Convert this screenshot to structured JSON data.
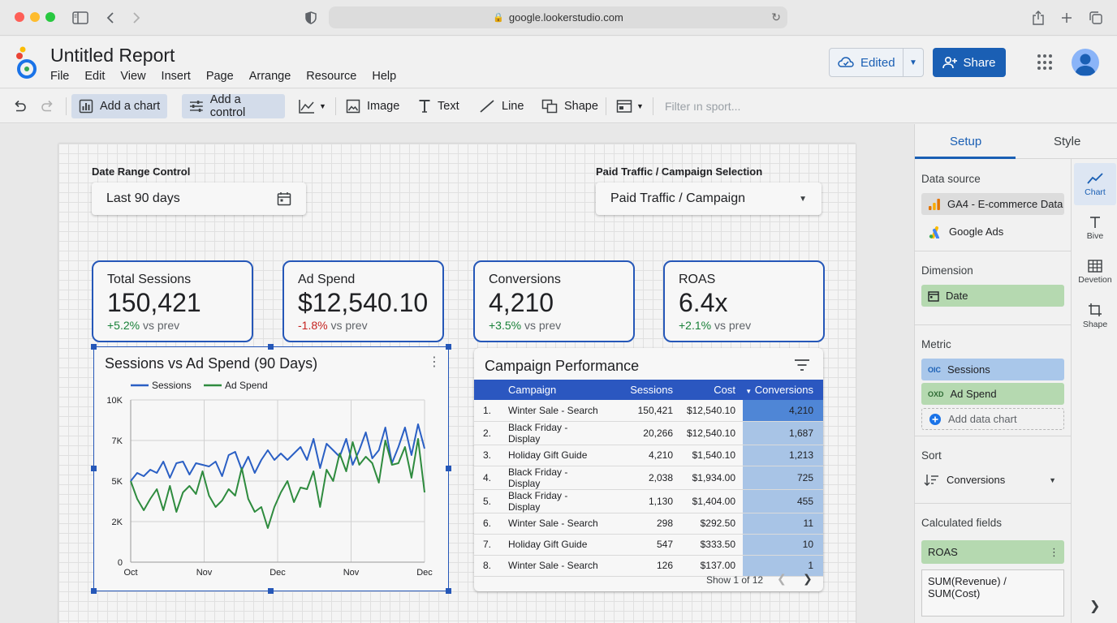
{
  "browser": {
    "url": "google.lookerstudio.com"
  },
  "header": {
    "title": "Untitled Report",
    "menu": [
      "File",
      "Edit",
      "View",
      "Insert",
      "Page",
      "Arrange",
      "Resource",
      "Help"
    ],
    "edited_label": "Edited",
    "share_label": "Share"
  },
  "toolbar": {
    "add_chart": "Add a chart",
    "add_control": "Add a control",
    "image": "Image",
    "text": "Text",
    "line": "Line",
    "shape": "Shape",
    "filter_placeholder": "Filter ın sport..."
  },
  "controls": {
    "date_range": {
      "label": "Date Range Control",
      "value": "Last 90 days"
    },
    "selection": {
      "label": "Paid Traffic / Campaign Selection",
      "value": "Paid Traffic / Campaign"
    }
  },
  "kpis": [
    {
      "label": "Total Sessions",
      "value": "150,421",
      "delta": "+5.2%",
      "delta_suffix": "vs prev",
      "trend": "up"
    },
    {
      "label": "Ad Spend",
      "value": "$12,540.10",
      "delta": "-1.8%",
      "delta_suffix": "vs prev",
      "trend": "down"
    },
    {
      "label": "Conversions",
      "value": "4,210",
      "delta": "+3.5%",
      "delta_suffix": "vs prev",
      "trend": "up"
    },
    {
      "label": "ROAS",
      "value": "6.4x",
      "delta": "+2.1%",
      "delta_suffix": "vs prev",
      "trend": "up"
    }
  ],
  "chart": {
    "title": "Sessions vs Ad Spend (90 Days)"
  },
  "chart_data": {
    "type": "line",
    "title": "Sessions vs Ad Spend (90 Days)",
    "x_tick_labels": [
      "Oct",
      "Nov",
      "Dec",
      "Nov",
      "Dec"
    ],
    "y_tick_labels": [
      "0",
      "2K",
      "5K",
      "7K",
      "10K"
    ],
    "y_tick_values": [
      0,
      2500,
      5000,
      7500,
      10000
    ],
    "ylim": [
      0,
      10000
    ],
    "grid": true,
    "legend_position": "top-left",
    "series": [
      {
        "name": "Sessions",
        "color": "#2a5fc4",
        "values": [
          5000,
          5500,
          5300,
          5700,
          5500,
          6200,
          5200,
          6100,
          6200,
          5400,
          6100,
          6000,
          5900,
          6200,
          5300,
          6600,
          6800,
          5700,
          6500,
          5500,
          6300,
          6900,
          6300,
          6700,
          6300,
          6700,
          7100,
          6300,
          7600,
          5800,
          7300,
          6900,
          6500,
          7600,
          6000,
          6900,
          8000,
          6400,
          6900,
          8300,
          6100,
          7100,
          8300,
          6600,
          8500,
          7000
        ]
      },
      {
        "name": "Ad Spend",
        "color": "#2e8b3e",
        "values": [
          5000,
          3900,
          3200,
          3900,
          4500,
          3200,
          4700,
          3100,
          4300,
          4700,
          4200,
          5600,
          4100,
          3400,
          3800,
          4500,
          4100,
          5800,
          3900,
          3100,
          3400,
          2100,
          3400,
          4300,
          5000,
          3700,
          4600,
          4500,
          5600,
          3400,
          5700,
          5000,
          6700,
          5600,
          7400,
          6000,
          6500,
          6100,
          4900,
          7500,
          6000,
          6100,
          7100,
          5200,
          7600,
          4300
        ]
      }
    ]
  },
  "table": {
    "title": "Campaign Performance",
    "headers": {
      "campaign": "Campaign",
      "sessions": "Sessions",
      "cost": "Cost",
      "conversions": "Conversions"
    },
    "rows": [
      {
        "n": "1.",
        "campaign": "Winter Sale - Search",
        "sessions": "150,421",
        "cost": "$12,540.10",
        "conversions": "4,210"
      },
      {
        "n": "2.",
        "campaign": "Black Friday - Display",
        "sessions": "20,266",
        "cost": "$12,540.10",
        "conversions": "1,687"
      },
      {
        "n": "3.",
        "campaign": "Holiday Gift Guide",
        "sessions": "4,210",
        "cost": "$1,540.10",
        "conversions": "1,213"
      },
      {
        "n": "4.",
        "campaign": "Black Friday - Display",
        "sessions": "2,038",
        "cost": "$1,934.00",
        "conversions": "725"
      },
      {
        "n": "5.",
        "campaign": "Black Friday - Display",
        "sessions": "1,130",
        "cost": "$1,404.00",
        "conversions": "455"
      },
      {
        "n": "6.",
        "campaign": "Winter Sale - Search",
        "sessions": "298",
        "cost": "$292.50",
        "conversions": "11"
      },
      {
        "n": "7.",
        "campaign": "Holiday Gift Guide",
        "sessions": "547",
        "cost": "$333.50",
        "conversions": "10"
      },
      {
        "n": "8.",
        "campaign": "Winter Sale - Search",
        "sessions": "126",
        "cost": "$137.00",
        "conversions": "1"
      }
    ],
    "pagination": "Show 1 of 12"
  },
  "panel": {
    "tabs": {
      "setup": "Setup",
      "style": "Style"
    },
    "data_source_title": "Data source",
    "data_sources": [
      "GA4 - E-commerce Data",
      "Google Ads"
    ],
    "dimension_title": "Dimension",
    "dimension": "Date",
    "metric_title": "Metric",
    "metrics": [
      {
        "tag": "OIC",
        "label": "Sessions"
      },
      {
        "tag": "OXD",
        "label": "Ad Spend"
      }
    ],
    "add_metric": "Add data chart",
    "sort_title": "Sort",
    "sort_value": "Conversions",
    "calc_title": "Calculated fields",
    "calc_field": "ROAS",
    "formula": "SUM(Revenue) / SUM(Cost)",
    "rail": [
      "Chart",
      "Bive",
      "Devetion",
      "Shape"
    ]
  }
}
